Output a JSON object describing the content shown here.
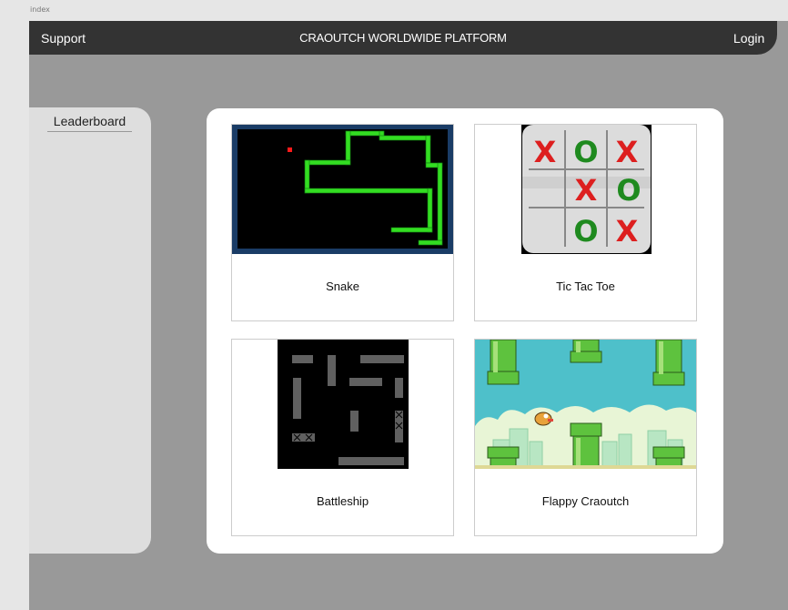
{
  "browser": {
    "tab_label": "index"
  },
  "navbar": {
    "support": "Support",
    "title": "CRAOUTCH WORLDWIDE PLATFORM",
    "login": "Login"
  },
  "sidebar": {
    "title": "Leaderboard"
  },
  "games": [
    {
      "name": "Snake",
      "icon": "snake-game-thumbnail"
    },
    {
      "name": "Tic Tac Toe",
      "icon": "tic-tac-toe-thumbnail",
      "board": [
        "X",
        "O",
        "X",
        "",
        "X",
        "O",
        "",
        "O",
        "X"
      ]
    },
    {
      "name": "Battleship",
      "icon": "battleship-thumbnail"
    },
    {
      "name": "Flappy Craoutch",
      "icon": "flappy-bird-thumbnail"
    }
  ],
  "colors": {
    "navbar": "#333333",
    "page_bg": "#999999",
    "panel_bg": "#ffffff",
    "sidebar_bg": "#dedede",
    "x_color": "#dd1f1f",
    "o_color": "#1f8a1f",
    "snake_green": "#33dd22"
  }
}
